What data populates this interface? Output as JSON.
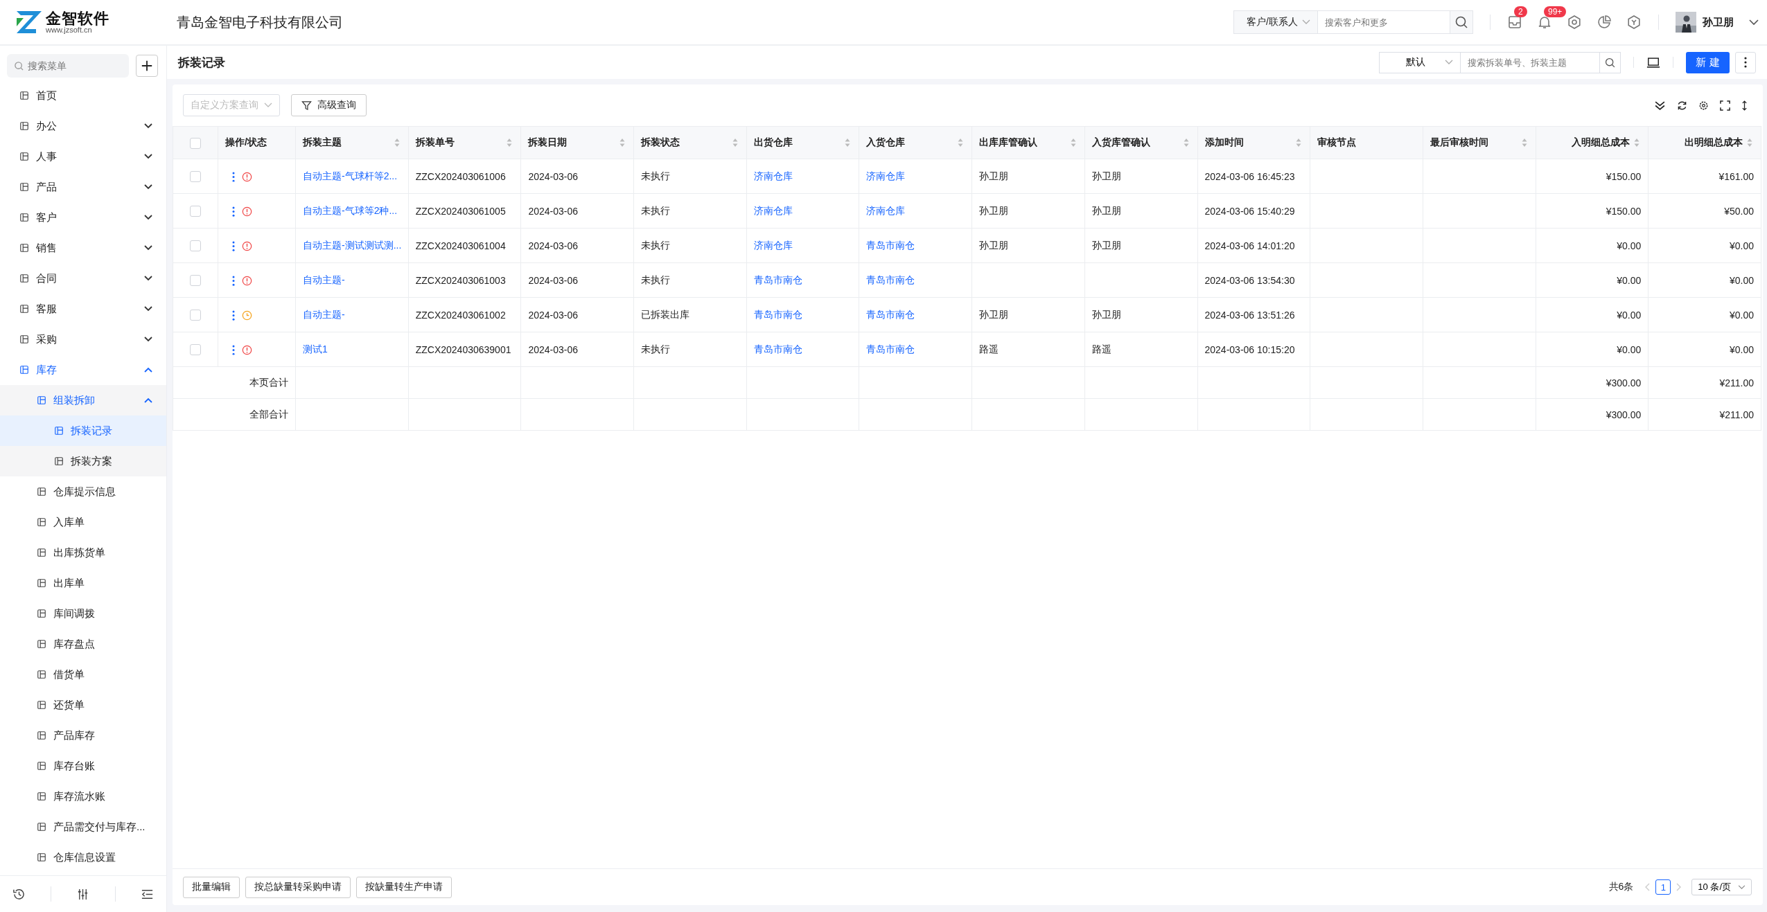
{
  "header": {
    "logo": {
      "name": "金智软件",
      "url": "www.jzsoft.cn"
    },
    "company": "青岛金智电子科技有限公司",
    "search": {
      "scope": "客户/联系人",
      "placeholder": "搜索客户和更多"
    },
    "tools": [
      {
        "kind": "inbox",
        "badge": "2"
      },
      {
        "kind": "bell",
        "badge": "99+"
      },
      {
        "kind": "settings"
      },
      {
        "kind": "chart"
      },
      {
        "kind": "cube"
      }
    ],
    "user": {
      "name": "孙卫朋"
    }
  },
  "sidebar": {
    "search": {
      "placeholder": "搜索菜单"
    },
    "items": [
      {
        "label": "首页",
        "selected": false
      },
      {
        "label": "办公",
        "expanded": false,
        "selected": false
      },
      {
        "label": "人事",
        "expanded": false,
        "selected": false
      },
      {
        "label": "产品",
        "expanded": false,
        "selected": false
      },
      {
        "label": "客户",
        "expanded": false,
        "selected": false
      },
      {
        "label": "销售",
        "expanded": false,
        "selected": false
      },
      {
        "label": "合同",
        "expanded": false,
        "selected": false
      },
      {
        "label": "客服",
        "expanded": false,
        "selected": false
      },
      {
        "label": "采购",
        "expanded": false,
        "selected": false
      },
      {
        "label": "库存",
        "expanded": true,
        "selected": true,
        "children": [
          {
            "label": "组装拆卸",
            "expanded": true,
            "selected": true,
            "children": [
              {
                "label": "拆装记录",
                "selected": true
              },
              {
                "label": "拆装方案",
                "selected": false
              }
            ]
          },
          {
            "label": "仓库提示信息",
            "selected": false
          },
          {
            "label": "入库单",
            "selected": false
          },
          {
            "label": "出库拣货单",
            "selected": false
          },
          {
            "label": "出库单",
            "selected": false
          },
          {
            "label": "库间调拨",
            "selected": false
          },
          {
            "label": "库存盘点",
            "selected": false
          },
          {
            "label": "借货单",
            "selected": false
          },
          {
            "label": "还货单",
            "selected": false
          },
          {
            "label": "产品库存",
            "selected": false
          },
          {
            "label": "库存台账",
            "selected": false
          },
          {
            "label": "库存流水账",
            "selected": false
          },
          {
            "label": "产品需交付与库存...",
            "selected": false
          },
          {
            "label": "仓库信息设置",
            "selected": false
          }
        ]
      }
    ]
  },
  "page": {
    "title": "拆装记录",
    "view": "默认",
    "search": {
      "placeholder": "搜索拆装单号、拆装主题"
    },
    "new_button": "新 建"
  },
  "toolbar": {
    "scheme": {
      "placeholder": "自定义方案查询"
    },
    "advanced": "高级查询"
  },
  "table": {
    "all_checked": false,
    "action_header": "操作/状态",
    "columns": [
      {
        "label": "拆装主题",
        "kind": "link",
        "sortable": true
      },
      {
        "label": "拆装单号",
        "kind": "text",
        "sortable": true
      },
      {
        "label": "拆装日期",
        "kind": "text",
        "sortable": true
      },
      {
        "label": "拆装状态",
        "kind": "text",
        "sortable": true
      },
      {
        "label": "出货仓库",
        "kind": "link",
        "sortable": true
      },
      {
        "label": "入货仓库",
        "kind": "link",
        "sortable": true
      },
      {
        "label": "出库库管确认",
        "kind": "text",
        "sortable": true
      },
      {
        "label": "入货库管确认",
        "kind": "text",
        "sortable": true
      },
      {
        "label": "添加时间",
        "kind": "text",
        "sortable": true
      },
      {
        "label": "审核节点",
        "kind": "text",
        "sortable": false
      },
      {
        "label": "最后审核时间",
        "kind": "text",
        "sortable": true
      },
      {
        "label": "入明细总成本",
        "kind": "money",
        "sortable": true
      },
      {
        "label": "出明细总成本",
        "kind": "money",
        "sortable": true
      }
    ],
    "rows": [
      {
        "checked": false,
        "kind": "alert",
        "cells": [
          "自动主题-气球杆等2...",
          "ZZCX202403061006",
          "2024-03-06",
          "未执行",
          "济南仓库",
          "济南仓库",
          "孙卫朋",
          "孙卫朋",
          "2024-03-06 16:45:23",
          null,
          null,
          "¥150.00",
          "¥161.00"
        ]
      },
      {
        "checked": false,
        "kind": "alert",
        "cells": [
          "自动主题-气球等2种...",
          "ZZCX202403061005",
          "2024-03-06",
          "未执行",
          "济南仓库",
          "济南仓库",
          "孙卫朋",
          "孙卫朋",
          "2024-03-06 15:40:29",
          null,
          null,
          "¥150.00",
          "¥50.00"
        ]
      },
      {
        "checked": false,
        "kind": "alert",
        "cells": [
          "自动主题-测试测试测...",
          "ZZCX202403061004",
          "2024-03-06",
          "未执行",
          "济南仓库",
          "青岛市南仓",
          "孙卫朋",
          "孙卫朋",
          "2024-03-06 14:01:20",
          null,
          null,
          "¥0.00",
          "¥0.00"
        ]
      },
      {
        "checked": false,
        "kind": "alert",
        "cells": [
          "自动主题-",
          "ZZCX202403061003",
          "2024-03-06",
          "未执行",
          "青岛市南仓",
          "青岛市南仓",
          null,
          null,
          "2024-03-06 13:54:30",
          null,
          null,
          "¥0.00",
          "¥0.00"
        ]
      },
      {
        "checked": false,
        "kind": "pending",
        "cells": [
          "自动主题-",
          "ZZCX202403061002",
          "2024-03-06",
          "已拆装出库",
          "青岛市南仓",
          "青岛市南仓",
          "孙卫朋",
          "孙卫朋",
          "2024-03-06 13:51:26",
          null,
          null,
          "¥0.00",
          "¥0.00"
        ]
      },
      {
        "checked": false,
        "kind": "alert",
        "cells": [
          "测试1",
          "ZZCX2024030639001",
          "2024-03-06",
          "未执行",
          "青岛市南仓",
          "青岛市南仓",
          "路遥",
          "路遥",
          "2024-03-06 10:15:20",
          null,
          null,
          "¥0.00",
          "¥0.00"
        ]
      }
    ],
    "totals": [
      {
        "label": "本页合计",
        "in_cost": "¥300.00",
        "out_cost": "¥211.00"
      },
      {
        "label": "全部合计",
        "in_cost": "¥300.00",
        "out_cost": "¥211.00"
      }
    ]
  },
  "footer": {
    "buttons": [
      "批量编辑",
      "按总缺量转采购申请",
      "按缺量转生产申请"
    ],
    "total": "共6条",
    "pages": [
      {
        "label": "1",
        "selected": true
      }
    ],
    "page_size": "10 条/页"
  }
}
